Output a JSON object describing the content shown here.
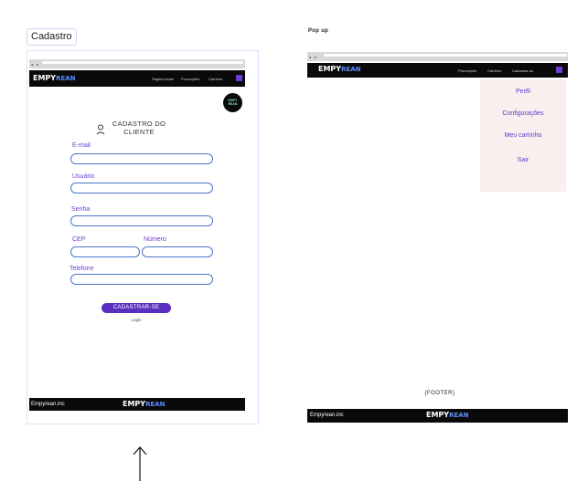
{
  "labels": {
    "cadastro": "Cadastro",
    "popup": "Pop up",
    "footer_caption": "{FOOTER}"
  },
  "brand": {
    "logo_top": "EMPY",
    "logo_bottom": "REAN",
    "company": "Empyrean.inc"
  },
  "nav_left": {
    "links": [
      "Página inicial",
      "Promoções",
      "Carrinho"
    ]
  },
  "nav_right": {
    "links": [
      "Promoções",
      "Carrinho",
      "Cadastrar-se"
    ]
  },
  "form": {
    "title_line1": "CADASTRO DO",
    "title_line2": "CLIENTE",
    "email_label": "E-mail",
    "user_label": "Usuário",
    "password_label": "Senha",
    "cep_label": "CEP",
    "number_label": "Número",
    "phone_label": "Telefone",
    "submit": "CADASTRAR-SE",
    "login": "Login"
  },
  "menu": {
    "items": [
      "Perfil",
      "Configurações",
      "Meu carrinho",
      "Sair"
    ]
  },
  "colors": {
    "accent": "#5a2fc0",
    "field_border": "#4a74c9",
    "nav_bg": "#0a0a0a",
    "menu_bg": "#f9efee"
  }
}
